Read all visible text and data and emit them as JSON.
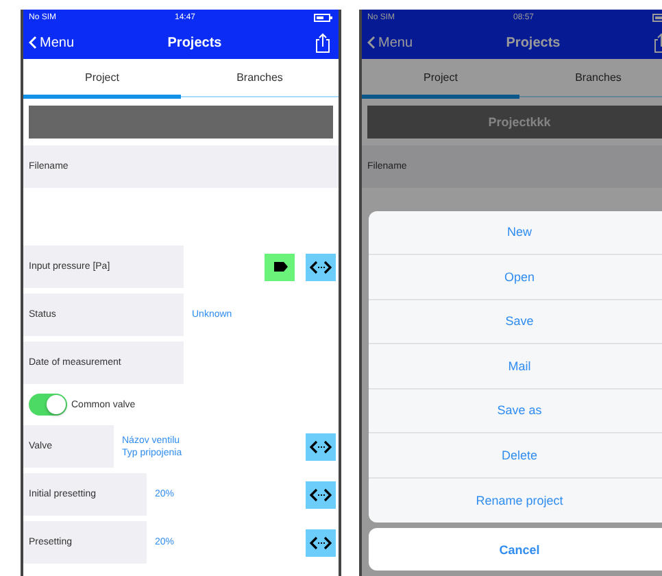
{
  "left_screen": {
    "status": {
      "carrier": "No SIM",
      "time": "14:47"
    },
    "nav": {
      "back": "Menu",
      "title": "Projects"
    },
    "tabs": [
      {
        "label": "Project",
        "selected": true
      },
      {
        "label": "Branches",
        "selected": false
      }
    ],
    "rows": [
      {
        "kind": "full",
        "label": "Filename"
      },
      {
        "kind": "wide",
        "label": "Input pressure [Pa]",
        "buttons": [
          {
            "kind": "tag"
          },
          {
            "kind": "swap"
          }
        ]
      },
      {
        "kind": "wide",
        "label": "Status",
        "values": [
          "Unknown"
        ]
      },
      {
        "kind": "wide",
        "label": "Date of measurement"
      },
      {
        "kind": "toggle",
        "label": "Common valve",
        "on": true
      },
      {
        "kind": "narrow",
        "label": "Valve",
        "values": [
          "Názov ventilu",
          "Typ pripojenia"
        ],
        "buttons": [
          {
            "kind": "swap"
          }
        ]
      },
      {
        "kind": "medium",
        "label": "Initial presetting",
        "values": [
          "20%"
        ],
        "buttons": [
          {
            "kind": "swap"
          }
        ]
      },
      {
        "kind": "medium",
        "label": "Presetting",
        "values": [
          "20%"
        ],
        "buttons": [
          {
            "kind": "swap"
          }
        ]
      }
    ]
  },
  "right_screen": {
    "status": {
      "carrier": "No SIM",
      "time": "08:57"
    },
    "nav": {
      "back": "Menu",
      "title": "Projects"
    },
    "tabs": [
      {
        "label": "Project",
        "selected": true
      },
      {
        "label": "Branches",
        "selected": false
      }
    ],
    "project_name": "Projectkkk",
    "rows": [
      {
        "kind": "full",
        "label": "Filename"
      }
    ],
    "action_sheet": {
      "items": [
        "New",
        "Open",
        "Save",
        "Mail",
        "Save as",
        "Delete",
        "Rename project"
      ],
      "cancel": "Cancel"
    }
  }
}
